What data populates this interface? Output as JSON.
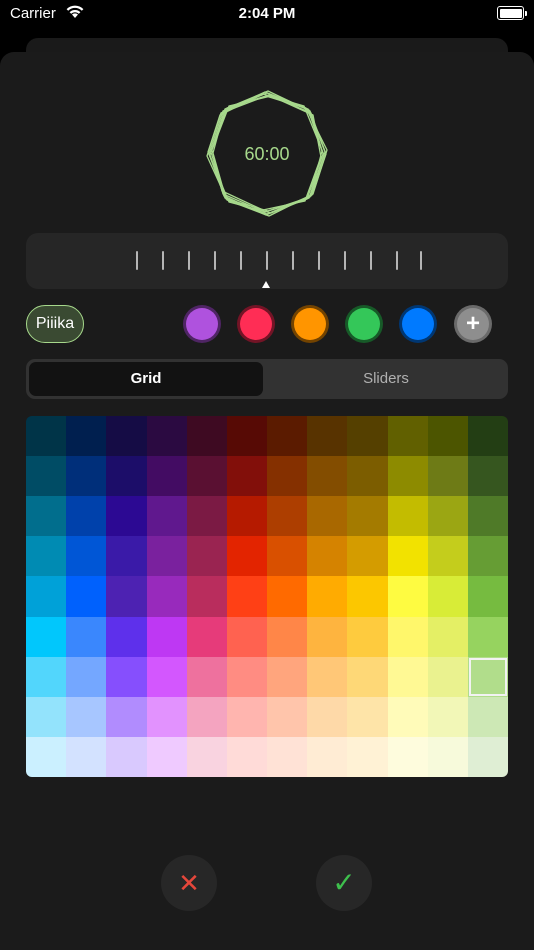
{
  "status_bar": {
    "carrier": "Carrier",
    "time": "2:04 PM"
  },
  "timer": {
    "display": "60:00",
    "accent": "#a7d98c"
  },
  "ruler": {
    "tick_count": 12
  },
  "name_chip": {
    "label": "Piiika"
  },
  "swatches": [
    {
      "name": "purple",
      "color": "#af52de"
    },
    {
      "name": "pink",
      "color": "#ff2d55"
    },
    {
      "name": "orange",
      "color": "#ff9500"
    },
    {
      "name": "green",
      "color": "#34c759"
    },
    {
      "name": "blue",
      "color": "#007aff"
    }
  ],
  "add_swatch": {
    "symbol": "+"
  },
  "segmented": {
    "grid_label": "Grid",
    "sliders_label": "Sliders",
    "selected": "Grid"
  },
  "color_grid": {
    "selected": {
      "row": 6,
      "col": 11
    },
    "rows": [
      [
        "#003448",
        "#001f4f",
        "#150c45",
        "#2b0a41",
        "#3e0a22",
        "#570a05",
        "#5b1b00",
        "#583300",
        "#554000",
        "#616000",
        "#4c5500",
        "#233e14"
      ],
      [
        "#004c65",
        "#002f7a",
        "#1c0d69",
        "#430c63",
        "#5a1032",
        "#820f0a",
        "#853000",
        "#834d00",
        "#7c5d00",
        "#8d8b00",
        "#6e7b16",
        "#36561f"
      ],
      [
        "#016e8d",
        "#0041ab",
        "#2c0993",
        "#60188e",
        "#7b1a44",
        "#b51a00",
        "#ad3e00",
        "#a96800",
        "#a47b00",
        "#c3bc00",
        "#9ba613",
        "#4f7a28"
      ],
      [
        "#008bb3",
        "#0056d6",
        "#3a1aa8",
        "#7a219e",
        "#9a2451",
        "#e32400",
        "#d95000",
        "#d58300",
        "#d49c00",
        "#f2e200",
        "#c4cd1c",
        "#669d34"
      ],
      [
        "#00a1d8",
        "#0061fd",
        "#4d22b2",
        "#982abc",
        "#b92d5d",
        "#ff4015",
        "#ff6a00",
        "#ffab01",
        "#fcc700",
        "#fefb41",
        "#d8ec37",
        "#76bb40"
      ],
      [
        "#01c7fc",
        "#3a87fd",
        "#5e30eb",
        "#be38f3",
        "#e63b7a",
        "#ff6250",
        "#ff8648",
        "#feb43f",
        "#fecb3e",
        "#fff76b",
        "#e4ef65",
        "#96d35f"
      ],
      [
        "#52d6fc",
        "#74a7ff",
        "#864ffd",
        "#d357fe",
        "#ee719e",
        "#ff8c82",
        "#ffa57d",
        "#ffc777",
        "#fed877",
        "#fff994",
        "#eaf28f",
        "#b1dd8b"
      ],
      [
        "#93e3fc",
        "#a7c6ff",
        "#b18cfe",
        "#e292fe",
        "#f4a4c0",
        "#ffb5af",
        "#ffc5ab",
        "#fed9a8",
        "#fee4a8",
        "#fffbb9",
        "#f2f7b7",
        "#cde8b5"
      ],
      [
        "#cbf0ff",
        "#d3e2ff",
        "#d9c9fe",
        "#efcaff",
        "#f9d3e0",
        "#ffdbd8",
        "#ffe2d6",
        "#ffecd4",
        "#fff2d5",
        "#fefcdd",
        "#f7fadb",
        "#dfeed4"
      ]
    ]
  },
  "actions": {
    "cancel_symbol": "✕",
    "confirm_symbol": "✓"
  }
}
